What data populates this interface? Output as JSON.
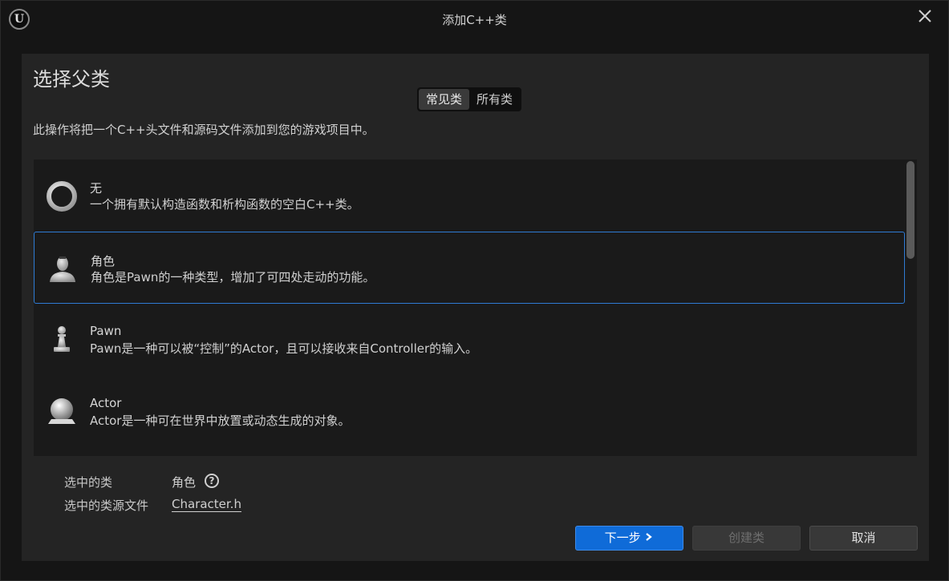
{
  "window": {
    "title": "添加C++类",
    "logo_text": "U"
  },
  "panel": {
    "heading": "选择父类",
    "tabs": [
      {
        "label": "常见类",
        "active": true
      },
      {
        "label": "所有类",
        "active": false
      }
    ],
    "description": "此操作将把一个C++头文件和源码文件添加到您的游戏项目中。"
  },
  "classes": [
    {
      "title": "无",
      "description": "一个拥有默认构造函数和析构函数的空白C++类。",
      "icon": "ring-icon",
      "selected": false
    },
    {
      "title": "角色",
      "description": "角色是Pawn的一种类型，增加了可四处走动的功能。",
      "icon": "character-icon",
      "selected": true
    },
    {
      "title": "Pawn",
      "description": "Pawn是一种可以被“控制”的Actor，且可以接收来自Controller的输入。",
      "icon": "pawn-icon",
      "selected": false
    },
    {
      "title": "Actor",
      "description": "Actor是一种可在世界中放置或动态生成的对象。",
      "icon": "actor-sphere-icon",
      "selected": false
    }
  ],
  "selection": {
    "class_label": "选中的类",
    "class_value": "角色",
    "file_label": "选中的类源文件",
    "file_value": "Character.h"
  },
  "buttons": {
    "next": "下一步",
    "create": "创建类",
    "cancel": "取消"
  },
  "colors": {
    "accent": "#0f6bd8",
    "selection_border": "#2f7bd4"
  }
}
